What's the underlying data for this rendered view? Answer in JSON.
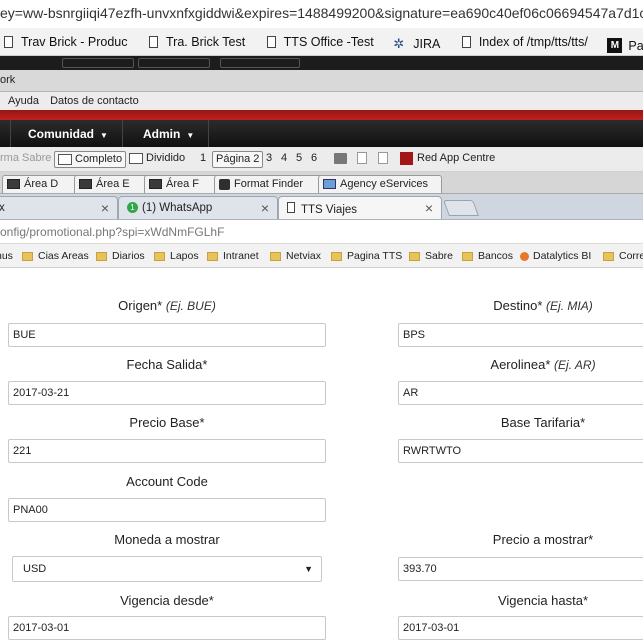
{
  "url_fragment": "ey=ww-bsnrgiiqi47ezfh-unvxnfxgiddwi&expires=1488499200&signature=ea690c40ef06c06694547a7d1c",
  "bookmarks_top": [
    {
      "label": "Trav Brick - Produc",
      "icon": "page-icon"
    },
    {
      "label": "Tra. Brick Test",
      "icon": "page-icon"
    },
    {
      "label": "TTS Office -Test",
      "icon": "page-icon"
    },
    {
      "label": "JIRA",
      "icon": "jira-icon"
    },
    {
      "label": "Index of /tmp/tts/tts/",
      "icon": "page-icon"
    },
    {
      "label": "Panel Sucurs",
      "icon": "m-icon"
    }
  ],
  "work_strip_text": "ork",
  "menu": [
    "Ayuda",
    "Datos de contacto"
  ],
  "nav": {
    "comunidad": "Comunidad",
    "admin": "Admin"
  },
  "toolbar": {
    "sabre": "rma Sabre",
    "completo": "Completo",
    "dividido": "Dividido",
    "page1": "1",
    "pagina2": "Página 2",
    "pages_rest": [
      "3",
      "4",
      "5",
      "6"
    ],
    "red_app": "Red App Centre"
  },
  "area_tabs": [
    "Área D",
    "Área E",
    "Área F",
    "Format Finder",
    "Agency eServices"
  ],
  "browser_tabs": [
    {
      "label": "x",
      "active": false
    },
    {
      "label": "(1) WhatsApp",
      "active": false
    },
    {
      "label": "TTS Viajes",
      "active": true
    }
  ],
  "address": "onfig/promotional.php?spi=xWdNmFGLhF",
  "bookmarks_bar2": [
    "nus",
    "Cias Areas",
    "Diarios",
    "Lapos",
    "Intranet",
    "Netviax",
    "Pagina TTS",
    "Sabre",
    "Bancos",
    "Datalytics BI",
    "Corre"
  ],
  "form": {
    "origen_label": "Origen*",
    "origen_hint": "(Ej. BUE)",
    "origen_value": "BUE",
    "destino_label": "Destino*",
    "destino_hint": "(Ej. MIA)",
    "destino_value": "BPS",
    "fecha_label": "Fecha Salida*",
    "fecha_value": "2017-03-21",
    "aerolinea_label": "Aerolinea*",
    "aerolinea_hint": "(Ej. AR)",
    "aerolinea_value": "AR",
    "precio_base_label": "Precio Base*",
    "precio_base_value": "221",
    "base_tarifaria_label": "Base Tarifaria*",
    "base_tarifaria_value": "RWRTWTO",
    "account_label": "Account Code",
    "account_value": "PNA00",
    "moneda_label": "Moneda a mostrar",
    "moneda_value": "USD",
    "precio_mostrar_label": "Precio a mostrar*",
    "precio_mostrar_value": "393.70",
    "vig_desde_label": "Vigencia desde*",
    "vig_desde_value": "2017-03-01",
    "vig_hasta_label": "Vigencia hasta*",
    "vig_hasta_value": "2017-03-01"
  }
}
